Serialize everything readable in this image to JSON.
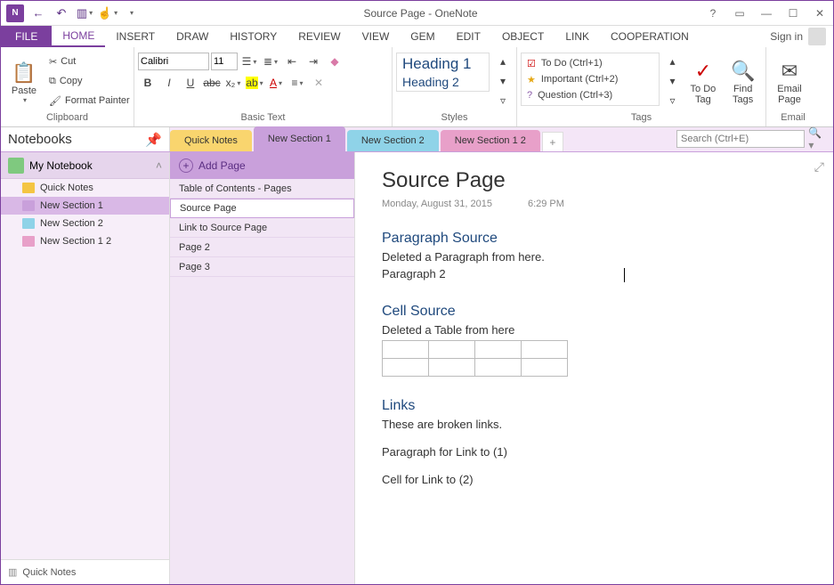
{
  "window": {
    "title": "Source Page - OneNote",
    "signin": "Sign in"
  },
  "menutabs": [
    "FILE",
    "HOME",
    "INSERT",
    "DRAW",
    "HISTORY",
    "REVIEW",
    "VIEW",
    "GEM",
    "EDIT",
    "OBJECT",
    "LINK",
    "COOPERATION"
  ],
  "ribbon": {
    "clipboard": {
      "paste": "Paste",
      "cut": "Cut",
      "copy": "Copy",
      "painter": "Format Painter",
      "label": "Clipboard"
    },
    "basictext": {
      "font": "Calibri",
      "size": "11",
      "label": "Basic Text"
    },
    "styles": {
      "h1": "Heading 1",
      "h2": "Heading 2",
      "label": "Styles"
    },
    "tags": {
      "items": [
        "To Do (Ctrl+1)",
        "Important (Ctrl+2)",
        "Question (Ctrl+3)"
      ],
      "todo": "To Do Tag",
      "find": "Find Tags",
      "label": "Tags"
    },
    "email": {
      "btn": "Email Page",
      "label": "Email"
    }
  },
  "notebooks": {
    "header": "Notebooks",
    "current": "My Notebook",
    "sections": [
      {
        "name": "Quick Notes",
        "color": "#f4c542"
      },
      {
        "name": "New Section 1",
        "color": "#c9a0db"
      },
      {
        "name": "New Section 2",
        "color": "#8fd3e8"
      },
      {
        "name": "New Section 1 2",
        "color": "#e8a0c9"
      }
    ],
    "quicknotes": "Quick Notes"
  },
  "sectiontabs": [
    "Quick Notes",
    "New Section 1",
    "New Section 2",
    "New Section 1 2"
  ],
  "search": {
    "placeholder": "Search (Ctrl+E)"
  },
  "pagelist": {
    "add": "Add Page",
    "pages": [
      "Table of Contents - Pages",
      "Source Page",
      "Link to Source Page",
      "Page 2",
      "Page 3"
    ]
  },
  "page": {
    "title": "Source Page",
    "date": "Monday, August 31, 2015",
    "time": "6:29 PM",
    "h_para": "Paragraph Source",
    "para1": "Deleted a Paragraph from here.",
    "para2": "Paragraph 2",
    "h_cell": "Cell Source",
    "cell1": "Deleted a Table from here",
    "h_links": "Links",
    "links1": "These are broken links.",
    "links2": "Paragraph for Link to (1)",
    "links3": "Cell for Link to (2)"
  }
}
